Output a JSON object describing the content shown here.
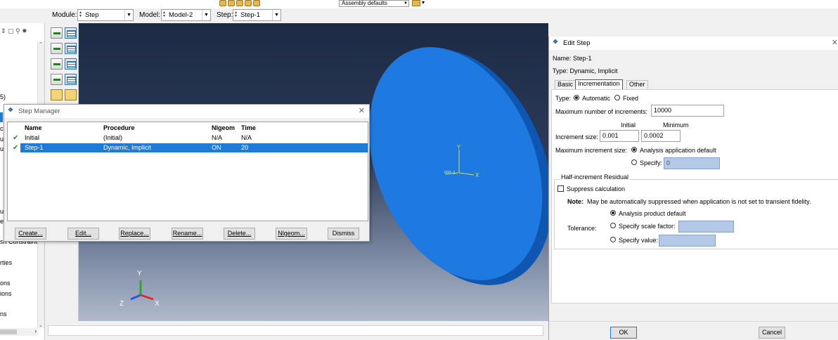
{
  "toolbar": {
    "assembly_display": "Assembly defaults"
  },
  "context": {
    "module_label": "Module:",
    "module_value": "Step",
    "model_label": "Model:",
    "model_value": "Model-2",
    "step_label": "Step:",
    "step_value": "Step-1"
  },
  "tree": {
    "fragments": [
      "5)",
      "cu",
      "ur",
      "ur",
      "u",
      "e",
      "sh Constraint",
      "rties",
      "ons",
      "ions",
      "ns"
    ]
  },
  "viewport": {
    "part_label": "Y",
    "part_axis_x": "X",
    "part_origin": "RP-1",
    "triad": {
      "x": "X",
      "y": "Y",
      "z": "Z"
    },
    "part_color": "#1e7ae0"
  },
  "step_manager": {
    "title": "Step Manager",
    "columns": [
      "Name",
      "Procedure",
      "Nlgeom",
      "Time"
    ],
    "rows": [
      {
        "name": "Initial",
        "procedure": "(Initial)",
        "nlgeom": "N/A",
        "time": "N/A"
      },
      {
        "name": "Step-1",
        "procedure": "Dynamic, Implicit",
        "nlgeom": "ON",
        "time": "20"
      }
    ],
    "buttons": {
      "create": "Create...",
      "edit": "Edit...",
      "replace": "Replace...",
      "rename": "Rename...",
      "delete": "Delete...",
      "nlgeom": "Nlgeom...",
      "dismiss": "Dismiss"
    }
  },
  "edit_step": {
    "title": "Edit Step",
    "name_line": "Name: Step-1",
    "type_line": "Type: Dynamic, Implicit",
    "tabs": [
      "Basic",
      "Incrementation",
      "Other"
    ],
    "type_label": "Type:",
    "type_automatic": "Automatic",
    "type_fixed": "Fixed",
    "max_increments_label": "Maximum number of increments:",
    "max_increments_value": "10000",
    "initial_label": "Initial",
    "minimum_label": "Minimum",
    "increment_size_label": "Increment size:",
    "increment_initial": "0.001",
    "increment_minimum": "0.0002",
    "max_increment_label": "Maximum increment size:",
    "max_increment_default": "Analysis application default",
    "max_increment_specify": "Specify:",
    "max_increment_specify_value": "0",
    "half_increment_label": "Half-increment Residual",
    "suppress_label": "Suppress calculation",
    "note_label": "Note:",
    "note_text": "May be automatically suppressed when application is not set to transient fidelity.",
    "tolerance_label": "Tolerance:",
    "tol_default": "Analysis product default",
    "tol_scale": "Specify scale factor:",
    "tol_value": "Specify value:",
    "ok": "OK",
    "cancel": "Cancel"
  }
}
